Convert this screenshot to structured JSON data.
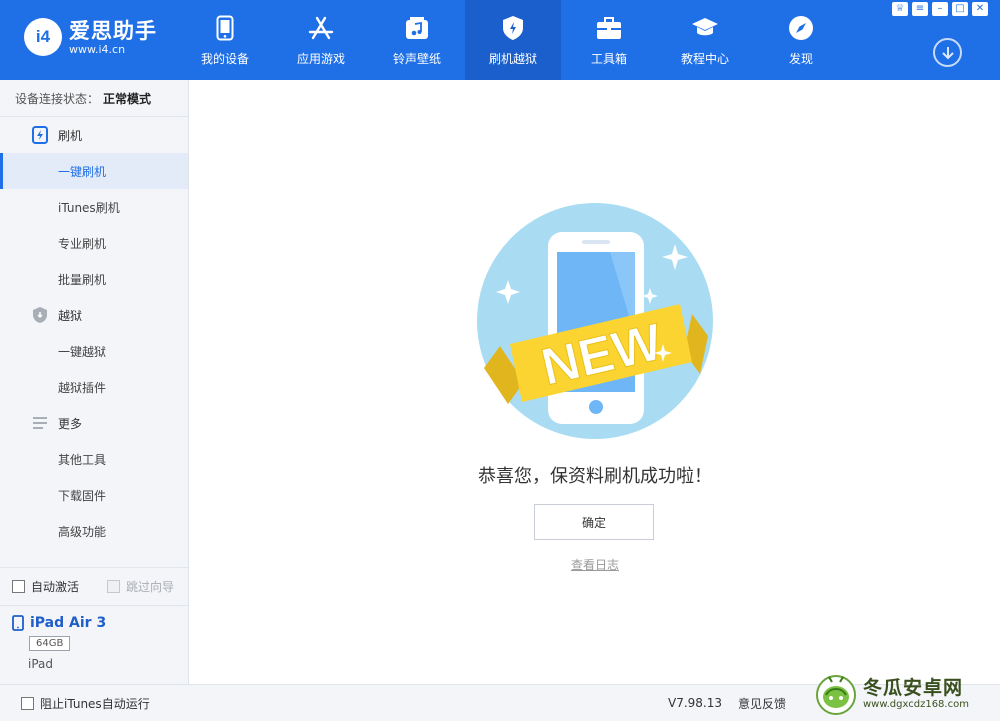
{
  "app": {
    "logo_badge": "i4",
    "logo_title": "爱思助手",
    "logo_url": "www.i4.cn"
  },
  "nav": [
    {
      "label": "我的设备",
      "icon": "phone-icon"
    },
    {
      "label": "应用游戏",
      "icon": "app-store-icon"
    },
    {
      "label": "铃声壁纸",
      "icon": "music-icon"
    },
    {
      "label": "刷机越狱",
      "icon": "flash-icon",
      "active": true
    },
    {
      "label": "工具箱",
      "icon": "toolbox-icon"
    },
    {
      "label": "教程中心",
      "icon": "graduation-cap-icon"
    },
    {
      "label": "发现",
      "icon": "compass-icon"
    }
  ],
  "window_controls": {
    "skin": "♕",
    "settings": "≡",
    "minimize": "–",
    "maximize": "□",
    "close": "✕"
  },
  "sidebar": {
    "status_label": "设备连接状态：",
    "status_value": "正常模式",
    "groups": [
      {
        "label": "刷机",
        "icon": "flash-phone-icon",
        "items": [
          "一键刷机",
          "iTunes刷机",
          "专业刷机",
          "批量刷机"
        ]
      },
      {
        "label": "越狱",
        "icon": "shield-icon",
        "items": [
          "一键越狱",
          "越狱插件"
        ]
      },
      {
        "label": "更多",
        "icon": "menu-lines-icon",
        "items": [
          "其他工具",
          "下载固件",
          "高级功能"
        ]
      }
    ],
    "active_item": "一键刷机",
    "auto_activate": "自动激活",
    "skip_guide": "跳过向导"
  },
  "device": {
    "name": "iPad Air 3",
    "capacity": "64GB",
    "type": "iPad"
  },
  "main": {
    "badge_text": "NEW",
    "message": "恭喜您，保资料刷机成功啦！",
    "ok_label": "确定",
    "log_link": "查看日志"
  },
  "bottom": {
    "block_itunes": "阻止iTunes自动运行",
    "version": "V7.98.13",
    "feedback": "意见反馈"
  },
  "watermark": {
    "title": "冬瓜安卓网",
    "url": "www.dgxcdz168.com"
  },
  "colors": {
    "primary": "#1f6fe6",
    "active_nav": "#1a5fcb",
    "sidebar_bg": "#f3f5f9",
    "illustration_circle": "#a9dcf3",
    "ribbon": "#fbd431"
  }
}
